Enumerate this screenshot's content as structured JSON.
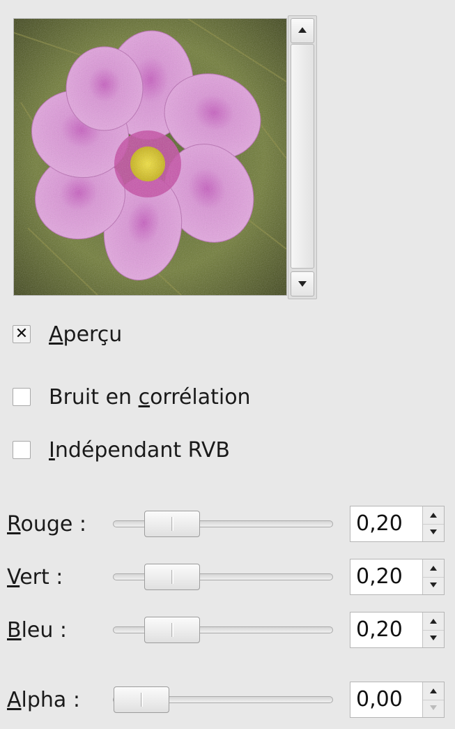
{
  "preview": {
    "image_label": "pink-flower-preview"
  },
  "options": {
    "preview_label": "Aperçu",
    "preview_checked": true,
    "correlated_label": "Bruit en corrélation",
    "correlated_checked": false,
    "independent_label": "Indépendant RVB",
    "independent_checked": false
  },
  "sliders": [
    {
      "label": "Rouge :",
      "value": "0,20",
      "fraction": 0.2
    },
    {
      "label": "Vert :",
      "value": "0,20",
      "fraction": 0.2
    },
    {
      "label": "Bleu :",
      "value": "0,20",
      "fraction": 0.2
    },
    {
      "label": "Alpha :",
      "value": "0,00",
      "fraction": 0.0
    }
  ],
  "icons": {
    "scroll_up": "arrow-up-icon",
    "scroll_down": "arrow-down-icon",
    "checkmark": "checkmark-icon"
  },
  "colors": {
    "background": "#e8e8e8",
    "petal": "#d98bd6",
    "flower_center": "#e8d21f",
    "foliage": "#5c6b2c"
  }
}
